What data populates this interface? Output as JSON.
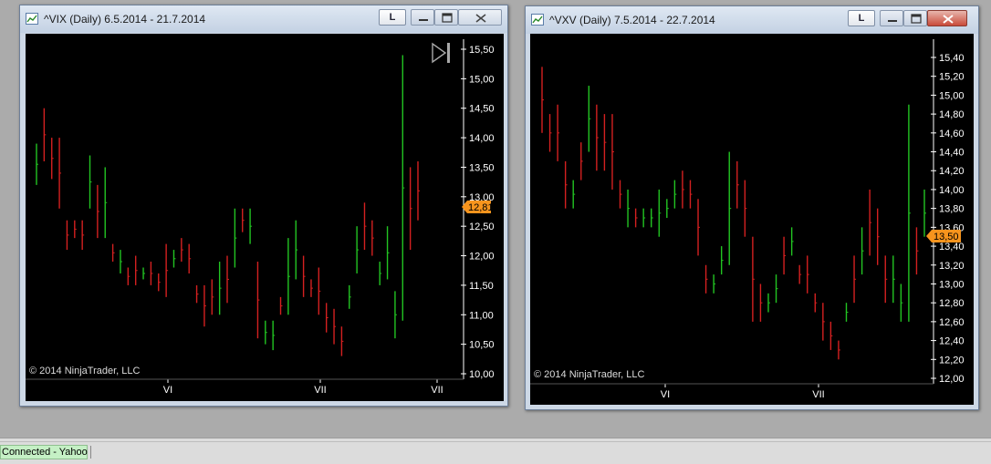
{
  "windows": [
    {
      "id": "vix",
      "title": "^VIX (Daily)  6.5.2014 - 21.7.2014",
      "lock_button": "L",
      "copyright": "© 2014 NinjaTrader, LLC",
      "price_marker": "12,81",
      "axis": {
        "ymin": 10.0,
        "ymax": 15.5,
        "ticks": [
          "10,00",
          "10,50",
          "11,00",
          "11,50",
          "12,00",
          "12,50",
          "13,00",
          "13,50",
          "14,00",
          "14,50",
          "15,00",
          "15,50"
        ]
      },
      "x_labels": [
        "VI",
        "VII",
        "VII"
      ],
      "colors": {
        "up": "#22c422",
        "down": "#d42020",
        "marker": "#f7941d"
      }
    },
    {
      "id": "vxv",
      "title": "^VXV (Daily)  7.5.2014 - 22.7.2014",
      "lock_button": "L",
      "copyright": "© 2014 NinjaTrader, LLC",
      "price_marker": "13,50",
      "axis": {
        "ymin": 12.0,
        "ymax": 15.4,
        "ticks": [
          "12,00",
          "12,20",
          "12,40",
          "12,60",
          "12,80",
          "13,00",
          "13,20",
          "13,40",
          "13,60",
          "13,80",
          "14,00",
          "14,20",
          "14,40",
          "14,60",
          "14,80",
          "15,00",
          "15,20",
          "15,40"
        ]
      },
      "x_labels": [
        "VI",
        "VII"
      ],
      "colors": {
        "up": "#22c422",
        "down": "#d42020",
        "marker": "#f7941d"
      }
    }
  ],
  "status_bar": {
    "connection": "Connected - Yahoo",
    "connection_color": "#c5f0c5"
  }
}
